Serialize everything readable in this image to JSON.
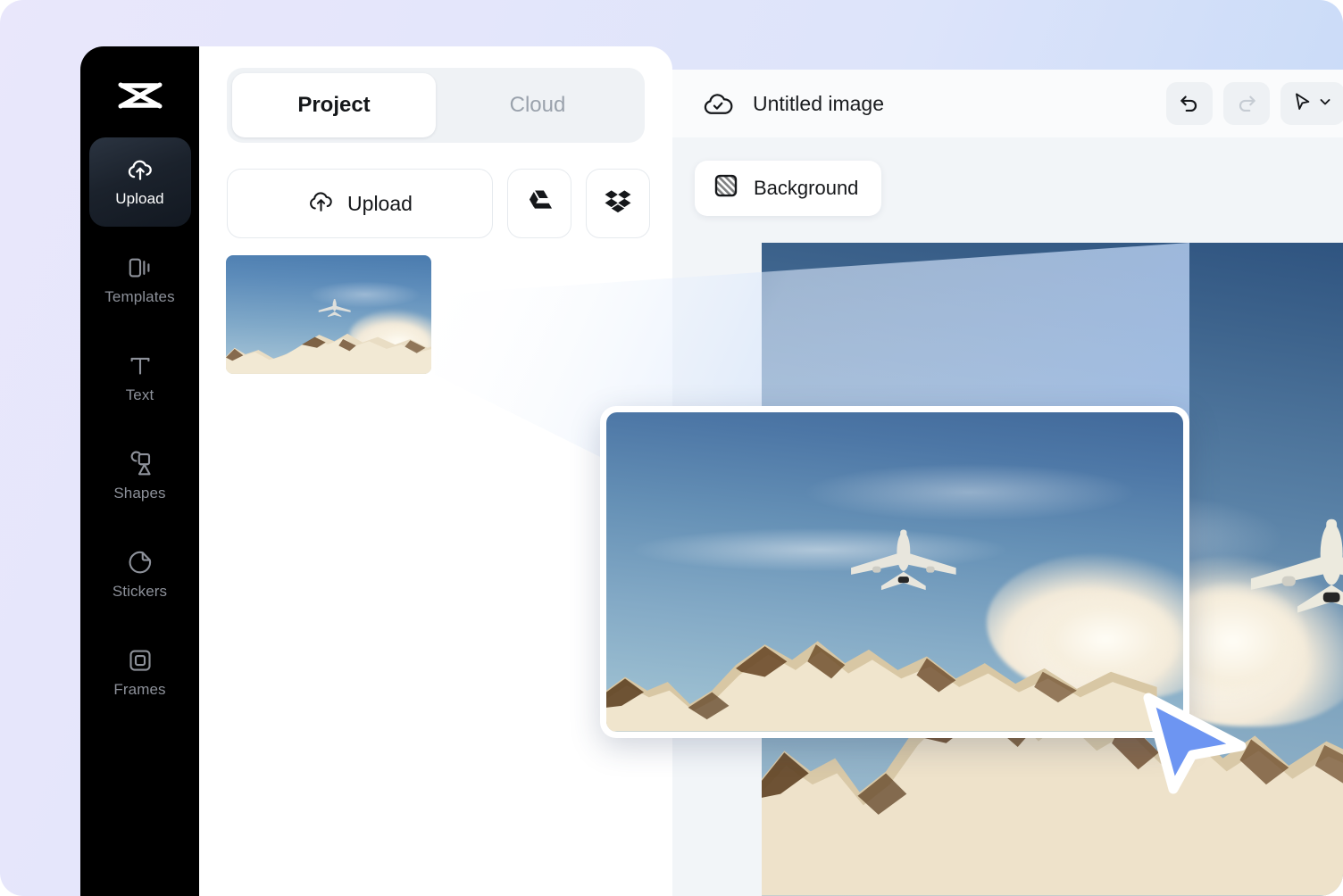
{
  "app": {
    "brand": "capcut-logo",
    "background_gradient_from": "#e9e7fb",
    "background_gradient_to": "#bcd4f7"
  },
  "sidebar": {
    "items": [
      {
        "label": "Upload",
        "icon": "cloud-upload-icon",
        "active": true
      },
      {
        "label": "Templates",
        "icon": "templates-icon",
        "active": false
      },
      {
        "label": "Text",
        "icon": "text-icon",
        "active": false
      },
      {
        "label": "Shapes",
        "icon": "shapes-icon",
        "active": false
      },
      {
        "label": "Stickers",
        "icon": "sticker-icon",
        "active": false
      },
      {
        "label": "Frames",
        "icon": "frames-icon",
        "active": false
      }
    ]
  },
  "panel": {
    "tabs": [
      {
        "label": "Project",
        "active": true
      },
      {
        "label": "Cloud",
        "active": false
      }
    ],
    "upload_label": "Upload",
    "upload_icon": "cloud-upload-icon",
    "google_drive_icon": "google-drive-icon",
    "dropbox_icon": "dropbox-icon",
    "thumbnail_alt": "airplane-over-snowy-mountains"
  },
  "header": {
    "cloud_status_icon": "cloud-check-icon",
    "document_title": "Untitled image",
    "actions": [
      {
        "name": "undo",
        "icon": "undo-icon",
        "enabled": true
      },
      {
        "name": "redo",
        "icon": "redo-icon",
        "enabled": false
      },
      {
        "name": "select-tool",
        "icon": "cursor-arrow-icon",
        "enabled": true,
        "has_chevron": true
      }
    ]
  },
  "toolbar": {
    "background_label": "Background",
    "background_icon": "checkered-square-icon"
  },
  "canvas": {
    "image_alt": "airplane-over-snowy-mountains",
    "drag_preview_alt": "airplane-over-snowy-mountains",
    "cursor_icon": "pointer-arrow-icon",
    "cursor_color": "#6d95f2"
  }
}
